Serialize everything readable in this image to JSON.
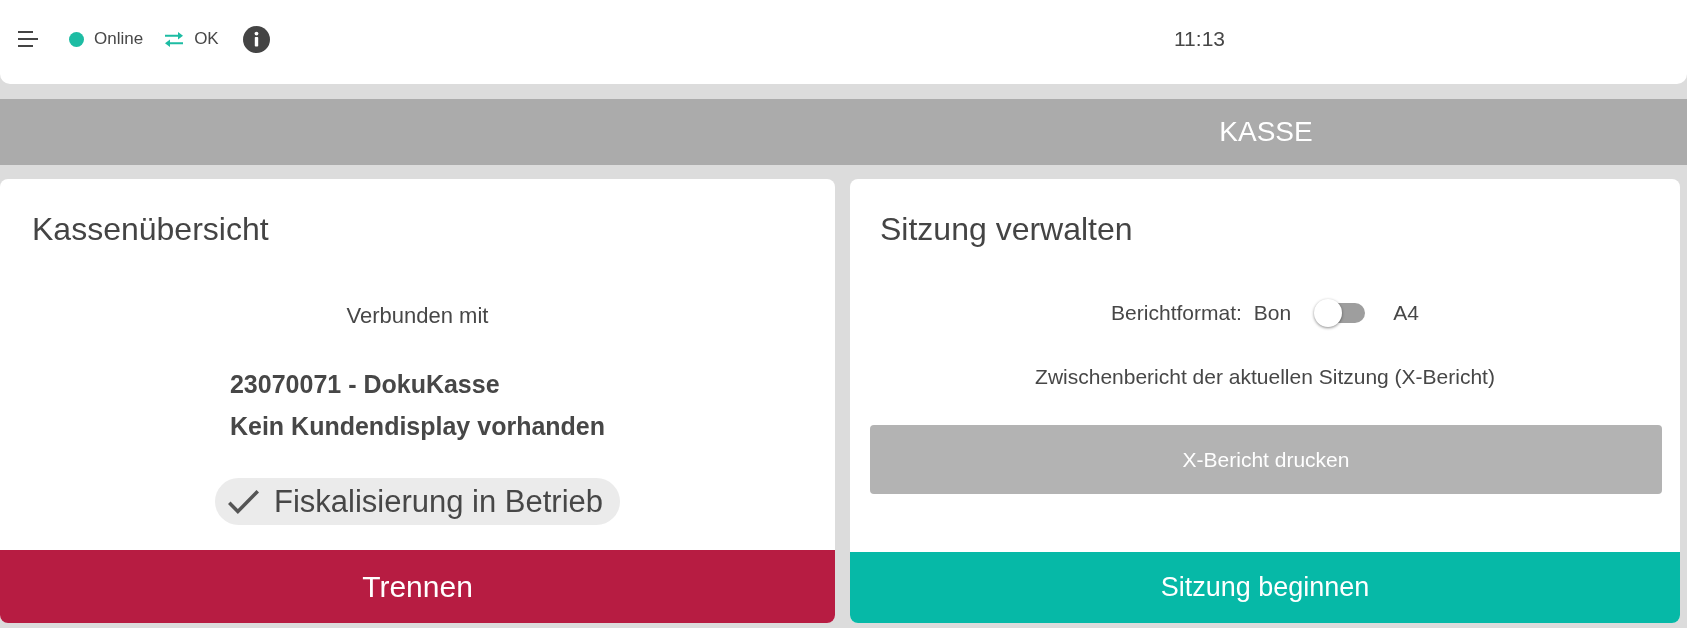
{
  "top_bar": {
    "status": [
      {
        "kind": "dot",
        "label": "Online",
        "color": "#1dbca3"
      },
      {
        "kind": "sync",
        "label": "OK",
        "color": "#1dbca3"
      }
    ],
    "time": "11:13"
  },
  "section_bar": {
    "title": "KASSE"
  },
  "register_card": {
    "title": "Kassenübersicht",
    "connected_label": "Verbunden mit",
    "register_lines": [
      "23070071 - DokuKasse",
      "Kein Kundendisplay vorhanden"
    ],
    "fiscal_status": {
      "label": "Fiskalisierung in Betrieb",
      "checked": true
    },
    "disconnect_button": {
      "label": "Trennen"
    }
  },
  "session_card": {
    "title": "Sitzung verwalten",
    "report_format": {
      "label": "Berichtformat:",
      "option_off": "Bon",
      "option_on": "A4",
      "on": false
    },
    "interim_report_label": "Zwischenbericht der aktuellen Sitzung (X-Bericht)",
    "print_button": {
      "label": "X-Bericht drucken",
      "disabled": true
    },
    "start_button": {
      "label": "Sitzung beginnen"
    }
  }
}
